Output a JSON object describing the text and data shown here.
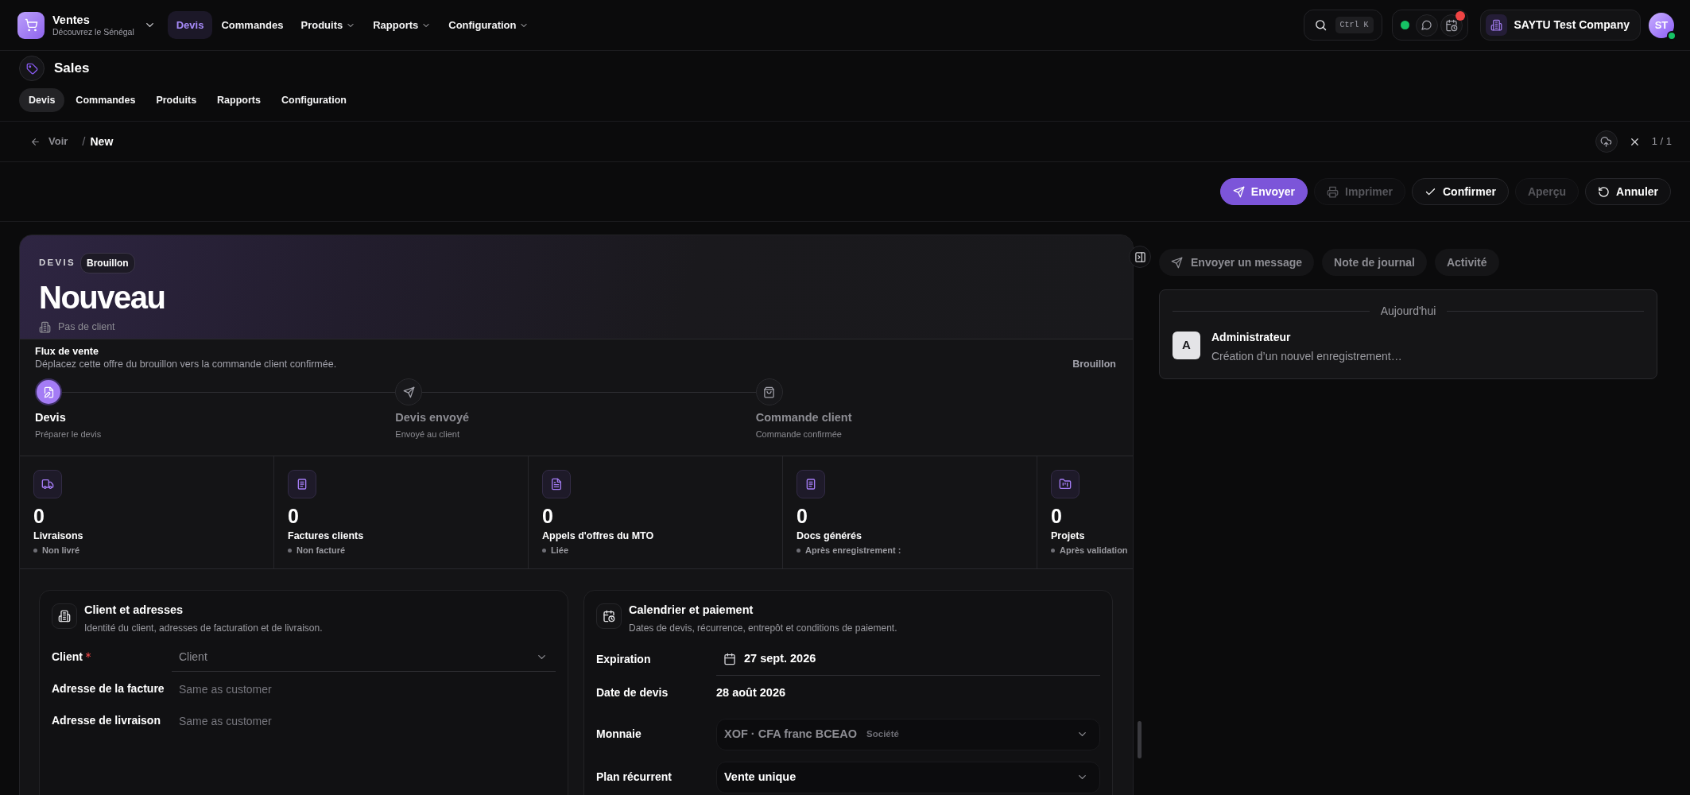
{
  "app_bar": {
    "app_name": "Ventes",
    "app_subtitle": "Découvrez le Sénégal",
    "menu": [
      {
        "label": "Devis",
        "selected": true,
        "dropdown": false
      },
      {
        "label": "Commandes",
        "selected": false,
        "dropdown": false
      },
      {
        "label": "Produits",
        "selected": false,
        "dropdown": true
      },
      {
        "label": "Rapports",
        "selected": false,
        "dropdown": true
      },
      {
        "label": "Configuration",
        "selected": false,
        "dropdown": true
      }
    ],
    "search_shortcut": "Ctrl K",
    "online": true,
    "activity_alert": true,
    "company": "SAYTU Test Company",
    "user_initials": "ST",
    "user_online": true
  },
  "module": {
    "title": "Sales",
    "tabs": [
      {
        "label": "Devis",
        "selected": true
      },
      {
        "label": "Commandes",
        "selected": false
      },
      {
        "label": "Produits",
        "selected": false
      },
      {
        "label": "Rapports",
        "selected": false
      },
      {
        "label": "Configuration",
        "selected": false
      }
    ]
  },
  "breadcrumb": {
    "back": "Voir",
    "separator": "/",
    "current": "New",
    "pager": "1 / 1"
  },
  "actions": [
    {
      "label": "Envoyer",
      "kind": "primary",
      "disabled": false
    },
    {
      "label": "Imprimer",
      "kind": "outline",
      "disabled": true
    },
    {
      "label": "Confirmer",
      "kind": "outline",
      "disabled": false
    },
    {
      "label": "Aperçu",
      "kind": "outline",
      "disabled": true
    },
    {
      "label": "Annuler",
      "kind": "outline",
      "disabled": false
    }
  ],
  "record": {
    "type": "DEVIS",
    "status": "Brouillon",
    "title": "Nouveau",
    "customer": "Pas de client"
  },
  "flow": {
    "title": "Flux de vente",
    "description": "Déplacez cette offre du brouillon vers la commande client confirmée.",
    "status": "Brouillon",
    "steps": [
      {
        "label": "Devis",
        "caption": "Préparer le devis",
        "selected": true
      },
      {
        "label": "Devis envoyé",
        "caption": "Envoyé au client",
        "selected": false
      },
      {
        "label": "Commande client",
        "caption": "Commande confirmée",
        "selected": false
      }
    ]
  },
  "stats": [
    {
      "value": "0",
      "label": "Livraisons",
      "note": "Non livré"
    },
    {
      "value": "0",
      "label": "Factures clients",
      "note": "Non facturé"
    },
    {
      "value": "0",
      "label": "Appels d'offres du MTO",
      "note": "Liée"
    },
    {
      "value": "0",
      "label": "Docs générés",
      "note": "Après enregistrement :"
    },
    {
      "value": "0",
      "label": "Projets",
      "note": "Après validation"
    }
  ],
  "sections": [
    {
      "title": "Client et adresses",
      "subtitle": "Identité du client, adresses de facturation et de livraison.",
      "fields": [
        {
          "label": "Client",
          "kind": "combo",
          "placeholder": "Client",
          "required": true,
          "disabled": false
        },
        {
          "label": "Adresse de la facture",
          "kind": "text",
          "placeholder": "Same as customer",
          "required": false,
          "disabled": false
        },
        {
          "label": "Adresse de livraison",
          "kind": "text",
          "placeholder": "Same as customer",
          "required": false,
          "disabled": false
        }
      ]
    },
    {
      "title": "Calendrier et paiement",
      "subtitle": "Dates de devis, récurrence, entrepôt et conditions de paiement.",
      "fields": [
        {
          "label": "Expiration",
          "kind": "date",
          "value": "27 sept. 2026",
          "required": false,
          "disabled": false
        },
        {
          "label": "Date de devis",
          "kind": "static",
          "value": "28 août 2026",
          "required": false,
          "disabled": false
        },
        {
          "label": "Monnaie",
          "kind": "select",
          "value": "XOF · CFA franc BCEAO",
          "tag": "Société",
          "required": false,
          "disabled": true
        },
        {
          "label": "Plan récurrent",
          "kind": "select",
          "value": "Vente unique",
          "required": false,
          "disabled": false
        }
      ]
    }
  ],
  "chatter": {
    "buttons": [
      "Envoyer un message",
      "Note de journal",
      "Activité"
    ],
    "day": "Aujourd'hui",
    "messages": [
      {
        "avatar": "A",
        "author": "Administrateur",
        "text": "Création d’un nouvel enregistrement…"
      }
    ]
  }
}
